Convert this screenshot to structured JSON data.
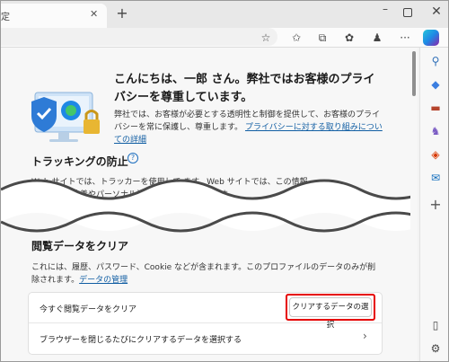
{
  "tabs": {
    "active_title": "定",
    "close_glyph": "✕",
    "new_tab_glyph": "+"
  },
  "window": {
    "minimize_glyph": "–",
    "close_glyph": "✕"
  },
  "toolbar": {
    "favorite_glyph": "☆",
    "favorites_glyph": "✩",
    "collections_glyph": "⧉",
    "extensions_glyph": "✿",
    "profile_glyph": "♟",
    "more_glyph": "···"
  },
  "rail": {
    "items": [
      {
        "name": "search",
        "glyph": "⚲",
        "color": "#2f6fb8"
      },
      {
        "name": "shopping",
        "glyph": "◆",
        "color": "#3b7ee0"
      },
      {
        "name": "tools",
        "glyph": "▬",
        "color": "#b5442c"
      },
      {
        "name": "games",
        "glyph": "♞",
        "color": "#7b5cc4"
      },
      {
        "name": "microsoft-365",
        "glyph": "◈",
        "color": "#d83b01"
      },
      {
        "name": "outlook",
        "glyph": "✉",
        "color": "#0f6cbd"
      },
      {
        "name": "add",
        "glyph": "+",
        "color": "#555555"
      }
    ],
    "split_glyph": "▯",
    "settings_glyph": "⚙"
  },
  "hero": {
    "title": "こんにちは、一郎 さん。弊社ではお客様のプライバシーを尊重しています。",
    "text": "弊社では、お客様が必要とする透明性と制御を提供して、お客様のプライバシーを常に保護し、尊重します。",
    "link": "プライバシーに対する取り組みについての詳細"
  },
  "tracking": {
    "title": "トラッキングの防止",
    "help_glyph": "?",
    "line1": "Web サイトでは、トラッカーを使用して                              ます。Web サイトでは、この情報",
    "line2": "のサイトの改善やパーソナル設                                   を行う場合があります",
    "line3": ""
  },
  "clear_browsing": {
    "title": "閲覧データをクリア",
    "desc": "これには、履歴、パスワード、Cookie などが含まれます。このプロファイルのデータのみが削除されます。",
    "desc_link": "データの管理",
    "row1_label": "今すぐ閲覧データをクリア",
    "choose_button": "クリアするデータの選択",
    "row2_label": "ブラウザーを閉じるたびにクリアするデータを選択する",
    "row2_chevron": "›"
  },
  "colors": {
    "highlight": "#e60000",
    "link": "#115ea3",
    "accent": "#1e6fbf"
  }
}
